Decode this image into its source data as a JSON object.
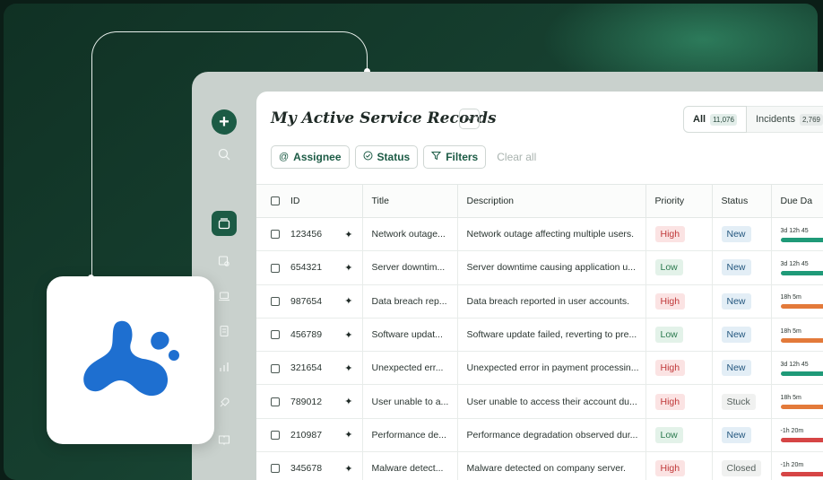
{
  "page": {
    "title": "My Active Service Records",
    "tabs": [
      {
        "label": "All",
        "count": "11,076"
      },
      {
        "label": "Incidents",
        "count": "2,769"
      }
    ]
  },
  "filters": {
    "chips": [
      {
        "label": "Assignee",
        "icon": "at-sign-icon"
      },
      {
        "label": "Status",
        "icon": "check-circle-icon"
      },
      {
        "label": "Filters",
        "icon": "funnel-icon"
      }
    ],
    "clear_label": "Clear all"
  },
  "table": {
    "columns": [
      "ID",
      "Title",
      "Description",
      "Priority",
      "Status",
      "Due Da"
    ],
    "rows": [
      {
        "id": "123456",
        "title": "Network outage...",
        "description": "Network outage affecting multiple users.",
        "priority": "High",
        "status": "New",
        "due": "3d 12h 45",
        "due_color": "#1f9a78"
      },
      {
        "id": "654321",
        "title": "Server downtim...",
        "description": "Server downtime causing application u...",
        "priority": "Low",
        "status": "New",
        "due": "3d 12h 45",
        "due_color": "#1f9a78"
      },
      {
        "id": "987654",
        "title": "Data breach rep...",
        "description": "Data breach reported in user accounts.",
        "priority": "High",
        "status": "New",
        "due": "18h 5m",
        "due_color": "#e37a3a"
      },
      {
        "id": "456789",
        "title": "Software updat...",
        "description": "Software update failed, reverting to pre...",
        "priority": "Low",
        "status": "New",
        "due": "18h 5m",
        "due_color": "#e37a3a"
      },
      {
        "id": "321654",
        "title": "Unexpected err...",
        "description": "Unexpected error in payment processin...",
        "priority": "High",
        "status": "New",
        "due": "3d 12h 45",
        "due_color": "#1f9a78"
      },
      {
        "id": "789012",
        "title": "User unable to a...",
        "description": "User unable to access their account du...",
        "priority": "High",
        "status": "Stuck",
        "due": "18h 5m",
        "due_color": "#e37a3a"
      },
      {
        "id": "210987",
        "title": "Performance de...",
        "description": "Performance degradation observed dur...",
        "priority": "Low",
        "status": "New",
        "due": "-1h 20m",
        "due_color": "#d64545"
      },
      {
        "id": "345678",
        "title": "Malware detect...",
        "description": "Malware detected on company server.",
        "priority": "High",
        "status": "Closed",
        "due": "-1h 20m",
        "due_color": "#d64545"
      }
    ]
  },
  "colors": {
    "brand": "#1c5b45",
    "logo_blue": "#1e6fd0",
    "high": "#c0393a",
    "low": "#2c7a4f",
    "new": "#24577f"
  },
  "rail_icons": [
    "plus-icon",
    "search-icon",
    "stack-icon",
    "ticket-user-icon",
    "laptop-icon",
    "document-icon",
    "chart-icon",
    "rocket-icon",
    "book-icon"
  ]
}
